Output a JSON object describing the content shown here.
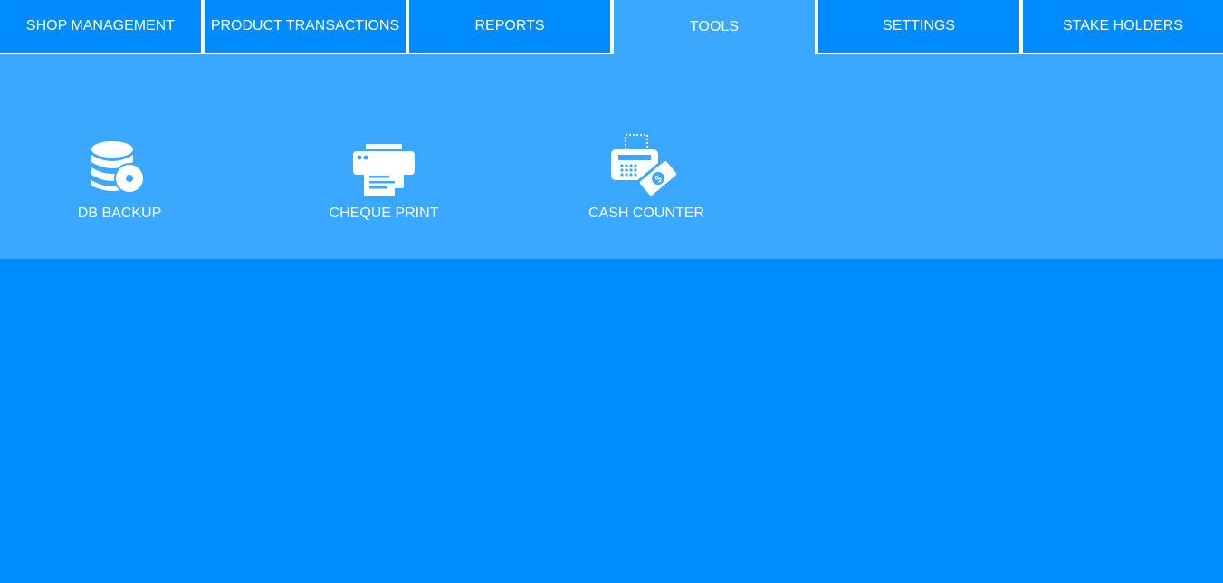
{
  "tabs": [
    {
      "label": "SHOP MANAGEMENT",
      "active": false
    },
    {
      "label": "PRODUCT TRANSACTIONS",
      "active": false
    },
    {
      "label": "REPORTS",
      "active": false
    },
    {
      "label": "TOOLS",
      "active": true
    },
    {
      "label": "SETTINGS",
      "active": false
    },
    {
      "label": "STAKE HOLDERS",
      "active": false
    }
  ],
  "tools": [
    {
      "label": "DB BACKUP",
      "icon": "database-backup-icon"
    },
    {
      "label": "CHEQUE PRINT",
      "icon": "printer-icon"
    },
    {
      "label": "CASH COUNTER",
      "icon": "cash-counter-icon"
    }
  ],
  "colors": {
    "background": "#008cff",
    "panel": "#3ba8ff",
    "text": "#ffffff",
    "separator": "#ffffff"
  }
}
